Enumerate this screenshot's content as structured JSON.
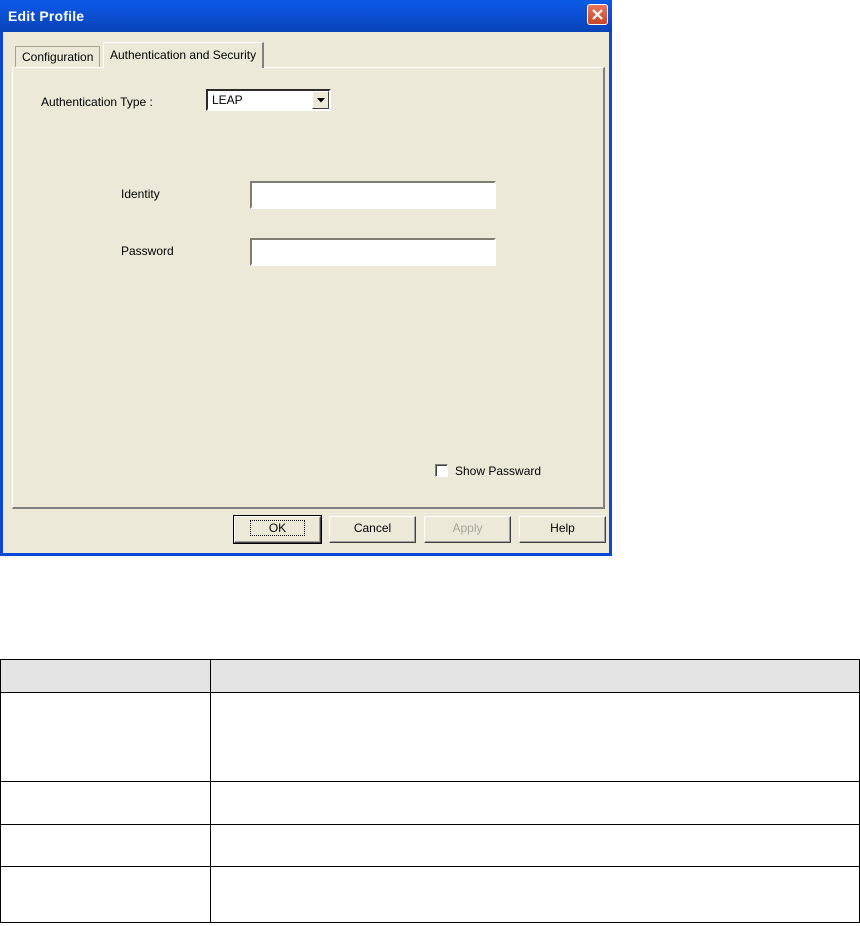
{
  "window": {
    "title": "Edit Profile"
  },
  "tabs": [
    {
      "label": "Configuration",
      "active": false
    },
    {
      "label": "Authentication and Security",
      "active": true
    }
  ],
  "auth": {
    "type_label": "Authentication Type :",
    "type_value": "LEAP",
    "identity_label": "Identity",
    "identity_value": "",
    "password_label": "Password",
    "password_value": "",
    "show_password_label": "Show Passward",
    "show_password_checked": false
  },
  "buttons": {
    "ok": "OK",
    "cancel": "Cancel",
    "apply": "Apply",
    "help": "Help"
  },
  "table": {
    "headers": [
      "",
      ""
    ],
    "rows": [
      [
        "",
        ""
      ],
      [
        "",
        ""
      ],
      [
        "",
        ""
      ],
      [
        "",
        ""
      ]
    ]
  },
  "colors": {
    "title_bar": "#0b4fd4",
    "dialog_bg": "#ece9d8",
    "close_button": "#c9452a",
    "table_header_bg": "#e4e4e4"
  },
  "icons": {
    "close": "close-icon",
    "dropdown": "chevron-down-icon"
  }
}
